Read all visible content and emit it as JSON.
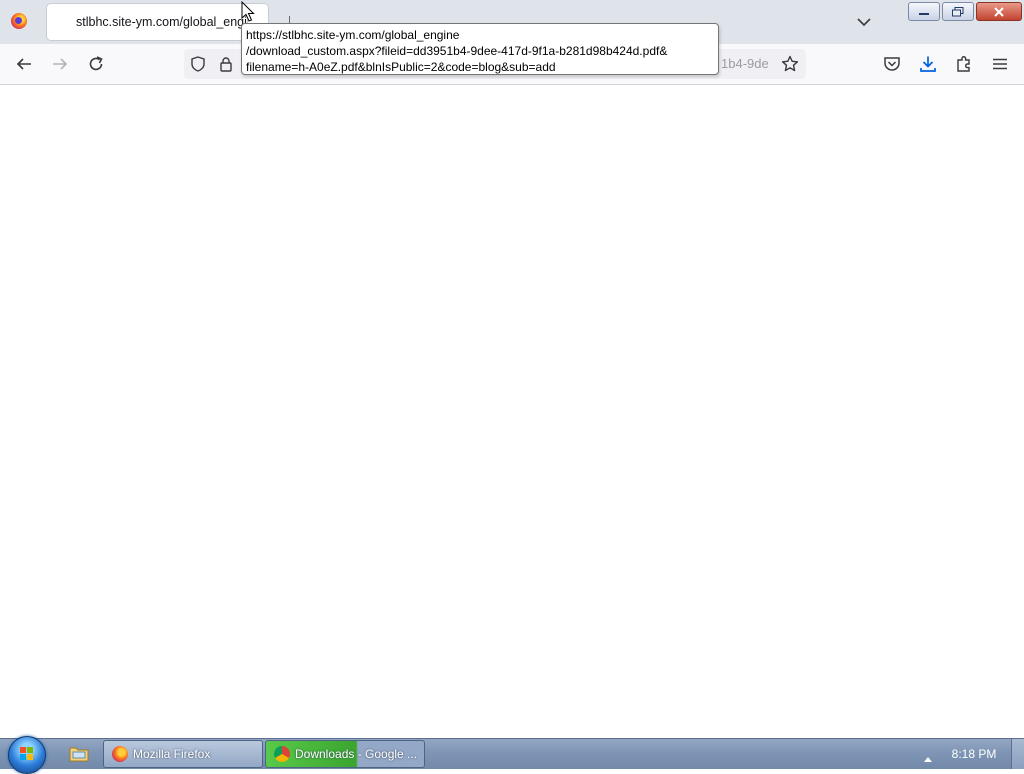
{
  "browser": {
    "tab": {
      "title": "stlbhc.site-ym.com/global_engine"
    },
    "urlbar": {
      "visible_text": "1b4-9de"
    },
    "tooltip": {
      "lines": [
        "https://stlbhc.site-ym.com/global_engine",
        "/download_custom.aspx?fileid=dd3951b4-9dee-417d-9f1a-b281d98b424d.pdf&",
        "filename=h-A0eZ.pdf&blnIsPublic=2&code=blog&sub=add"
      ]
    },
    "icons": {
      "app": "firefox-logo",
      "back": "arrow-left-icon",
      "forward": "arrow-right-icon",
      "reload": "reload-icon",
      "tracking": "shield-icon",
      "security": "lock-icon",
      "bookmark": "star-icon",
      "pocket": "pocket-icon",
      "downloads": "download-icon",
      "extensions": "puzzle-icon",
      "menu": "hamburger-menu-icon",
      "tablist": "chevron-down-icon"
    },
    "colors": {
      "accent": "#0060df",
      "toolbar": "#f9f9fb",
      "tabstrip": "#dfe3ea"
    }
  },
  "taskbar": {
    "items": [
      {
        "label": "Mozilla Firefox",
        "icon": "firefox-icon"
      },
      {
        "label": "Downloads - Google ...",
        "icon": "chrome-icon"
      }
    ],
    "clock": "8:18 PM"
  }
}
